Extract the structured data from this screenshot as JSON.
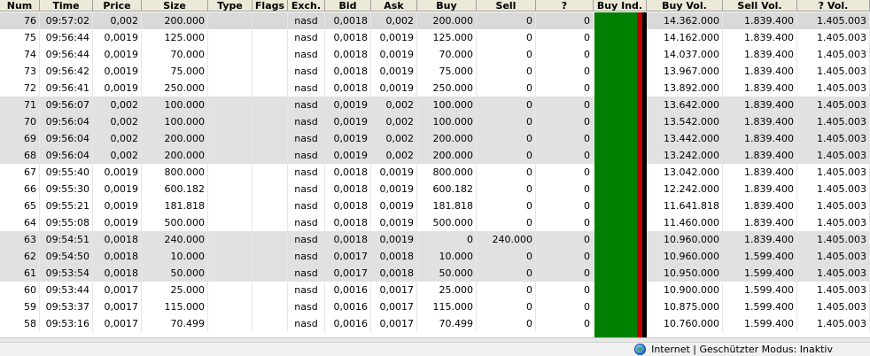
{
  "columns": [
    "Num",
    "Time",
    "Price",
    "Size",
    "Type",
    "Flags",
    "Exch.",
    "Bid",
    "Ask",
    "Buy",
    "Sell",
    "?",
    "Buy Ind.",
    "Buy Vol.",
    "Sell Vol.",
    "? Vol."
  ],
  "rows": [
    {
      "num": "76",
      "time": "09:57:02",
      "price": "0,002",
      "size": "200.000",
      "type": "",
      "flags": "",
      "exch": "nasd",
      "bid": "0,0018",
      "ask": "0,002",
      "buy": "200.000",
      "sell": "0",
      "q": "0",
      "buy_vol": "14.362.000",
      "sell_vol": "1.839.400",
      "q_vol": "1.405.003",
      "shade": "sel"
    },
    {
      "num": "75",
      "time": "09:56:44",
      "price": "0,0019",
      "size": "125.000",
      "type": "",
      "flags": "",
      "exch": "nasd",
      "bid": "0,0018",
      "ask": "0,0019",
      "buy": "125.000",
      "sell": "0",
      "q": "0",
      "buy_vol": "14.162.000",
      "sell_vol": "1.839.400",
      "q_vol": "1.405.003",
      "shade": ""
    },
    {
      "num": "74",
      "time": "09:56:44",
      "price": "0,0019",
      "size": "70.000",
      "type": "",
      "flags": "",
      "exch": "nasd",
      "bid": "0,0018",
      "ask": "0,0019",
      "buy": "70.000",
      "sell": "0",
      "q": "0",
      "buy_vol": "14.037.000",
      "sell_vol": "1.839.400",
      "q_vol": "1.405.003",
      "shade": ""
    },
    {
      "num": "73",
      "time": "09:56:42",
      "price": "0,0019",
      "size": "75.000",
      "type": "",
      "flags": "",
      "exch": "nasd",
      "bid": "0,0018",
      "ask": "0,0019",
      "buy": "75.000",
      "sell": "0",
      "q": "0",
      "buy_vol": "13.967.000",
      "sell_vol": "1.839.400",
      "q_vol": "1.405.003",
      "shade": ""
    },
    {
      "num": "72",
      "time": "09:56:41",
      "price": "0,0019",
      "size": "250.000",
      "type": "",
      "flags": "",
      "exch": "nasd",
      "bid": "0,0018",
      "ask": "0,0019",
      "buy": "250.000",
      "sell": "0",
      "q": "0",
      "buy_vol": "13.892.000",
      "sell_vol": "1.839.400",
      "q_vol": "1.405.003",
      "shade": ""
    },
    {
      "num": "71",
      "time": "09:56:07",
      "price": "0,002",
      "size": "100.000",
      "type": "",
      "flags": "",
      "exch": "nasd",
      "bid": "0,0019",
      "ask": "0,002",
      "buy": "100.000",
      "sell": "0",
      "q": "0",
      "buy_vol": "13.642.000",
      "sell_vol": "1.839.400",
      "q_vol": "1.405.003",
      "shade": "alt"
    },
    {
      "num": "70",
      "time": "09:56:04",
      "price": "0,002",
      "size": "100.000",
      "type": "",
      "flags": "",
      "exch": "nasd",
      "bid": "0,0019",
      "ask": "0,002",
      "buy": "100.000",
      "sell": "0",
      "q": "0",
      "buy_vol": "13.542.000",
      "sell_vol": "1.839.400",
      "q_vol": "1.405.003",
      "shade": "alt"
    },
    {
      "num": "69",
      "time": "09:56:04",
      "price": "0,002",
      "size": "200.000",
      "type": "",
      "flags": "",
      "exch": "nasd",
      "bid": "0,0019",
      "ask": "0,002",
      "buy": "200.000",
      "sell": "0",
      "q": "0",
      "buy_vol": "13.442.000",
      "sell_vol": "1.839.400",
      "q_vol": "1.405.003",
      "shade": "alt"
    },
    {
      "num": "68",
      "time": "09:56:04",
      "price": "0,002",
      "size": "200.000",
      "type": "",
      "flags": "",
      "exch": "nasd",
      "bid": "0,0019",
      "ask": "0,002",
      "buy": "200.000",
      "sell": "0",
      "q": "0",
      "buy_vol": "13.242.000",
      "sell_vol": "1.839.400",
      "q_vol": "1.405.003",
      "shade": "alt"
    },
    {
      "num": "67",
      "time": "09:55:40",
      "price": "0,0019",
      "size": "800.000",
      "type": "",
      "flags": "",
      "exch": "nasd",
      "bid": "0,0018",
      "ask": "0,0019",
      "buy": "800.000",
      "sell": "0",
      "q": "0",
      "buy_vol": "13.042.000",
      "sell_vol": "1.839.400",
      "q_vol": "1.405.003",
      "shade": ""
    },
    {
      "num": "66",
      "time": "09:55:30",
      "price": "0,0019",
      "size": "600.182",
      "type": "",
      "flags": "",
      "exch": "nasd",
      "bid": "0,0018",
      "ask": "0,0019",
      "buy": "600.182",
      "sell": "0",
      "q": "0",
      "buy_vol": "12.242.000",
      "sell_vol": "1.839.400",
      "q_vol": "1.405.003",
      "shade": ""
    },
    {
      "num": "65",
      "time": "09:55:21",
      "price": "0,0019",
      "size": "181.818",
      "type": "",
      "flags": "",
      "exch": "nasd",
      "bid": "0,0018",
      "ask": "0,0019",
      "buy": "181.818",
      "sell": "0",
      "q": "0",
      "buy_vol": "11.641.818",
      "sell_vol": "1.839.400",
      "q_vol": "1.405.003",
      "shade": ""
    },
    {
      "num": "64",
      "time": "09:55:08",
      "price": "0,0019",
      "size": "500.000",
      "type": "",
      "flags": "",
      "exch": "nasd",
      "bid": "0,0018",
      "ask": "0,0019",
      "buy": "500.000",
      "sell": "0",
      "q": "0",
      "buy_vol": "11.460.000",
      "sell_vol": "1.839.400",
      "q_vol": "1.405.003",
      "shade": ""
    },
    {
      "num": "63",
      "time": "09:54:51",
      "price": "0,0018",
      "size": "240.000",
      "type": "",
      "flags": "",
      "exch": "nasd",
      "bid": "0,0018",
      "ask": "0,0019",
      "buy": "0",
      "sell": "240.000",
      "q": "0",
      "buy_vol": "10.960.000",
      "sell_vol": "1.839.400",
      "q_vol": "1.405.003",
      "shade": "alt"
    },
    {
      "num": "62",
      "time": "09:54:50",
      "price": "0,0018",
      "size": "10.000",
      "type": "",
      "flags": "",
      "exch": "nasd",
      "bid": "0,0017",
      "ask": "0,0018",
      "buy": "10.000",
      "sell": "0",
      "q": "0",
      "buy_vol": "10.960.000",
      "sell_vol": "1.599.400",
      "q_vol": "1.405.003",
      "shade": "alt"
    },
    {
      "num": "61",
      "time": "09:53:54",
      "price": "0,0018",
      "size": "50.000",
      "type": "",
      "flags": "",
      "exch": "nasd",
      "bid": "0,0017",
      "ask": "0,0018",
      "buy": "50.000",
      "sell": "0",
      "q": "0",
      "buy_vol": "10.950.000",
      "sell_vol": "1.599.400",
      "q_vol": "1.405.003",
      "shade": "alt"
    },
    {
      "num": "60",
      "time": "09:53:44",
      "price": "0,0017",
      "size": "25.000",
      "type": "",
      "flags": "",
      "exch": "nasd",
      "bid": "0,0016",
      "ask": "0,0017",
      "buy": "25.000",
      "sell": "0",
      "q": "0",
      "buy_vol": "10.900.000",
      "sell_vol": "1.599.400",
      "q_vol": "1.405.003",
      "shade": ""
    },
    {
      "num": "59",
      "time": "09:53:37",
      "price": "0,0017",
      "size": "115.000",
      "type": "",
      "flags": "",
      "exch": "nasd",
      "bid": "0,0016",
      "ask": "0,0017",
      "buy": "115.000",
      "sell": "0",
      "q": "0",
      "buy_vol": "10.875.000",
      "sell_vol": "1.599.400",
      "q_vol": "1.405.003",
      "shade": ""
    },
    {
      "num": "58",
      "time": "09:53:16",
      "price": "0,0017",
      "size": "70.499",
      "type": "",
      "flags": "",
      "exch": "nasd",
      "bid": "0,0016",
      "ask": "0,0017",
      "buy": "70.499",
      "sell": "0",
      "q": "0",
      "buy_vol": "10.760.000",
      "sell_vol": "1.599.400",
      "q_vol": "1.405.003",
      "shade": ""
    }
  ],
  "buy_indicator": {
    "buy_fraction": 0.82,
    "sell_fraction": 0.1,
    "other_fraction": 0.08,
    "buy_color": "#008000",
    "sell_color": "#c00000",
    "other_color": "#000000"
  },
  "statusbar": {
    "icon": "globe-icon",
    "text": "Internet | Geschützter Modus: Inaktiv"
  }
}
